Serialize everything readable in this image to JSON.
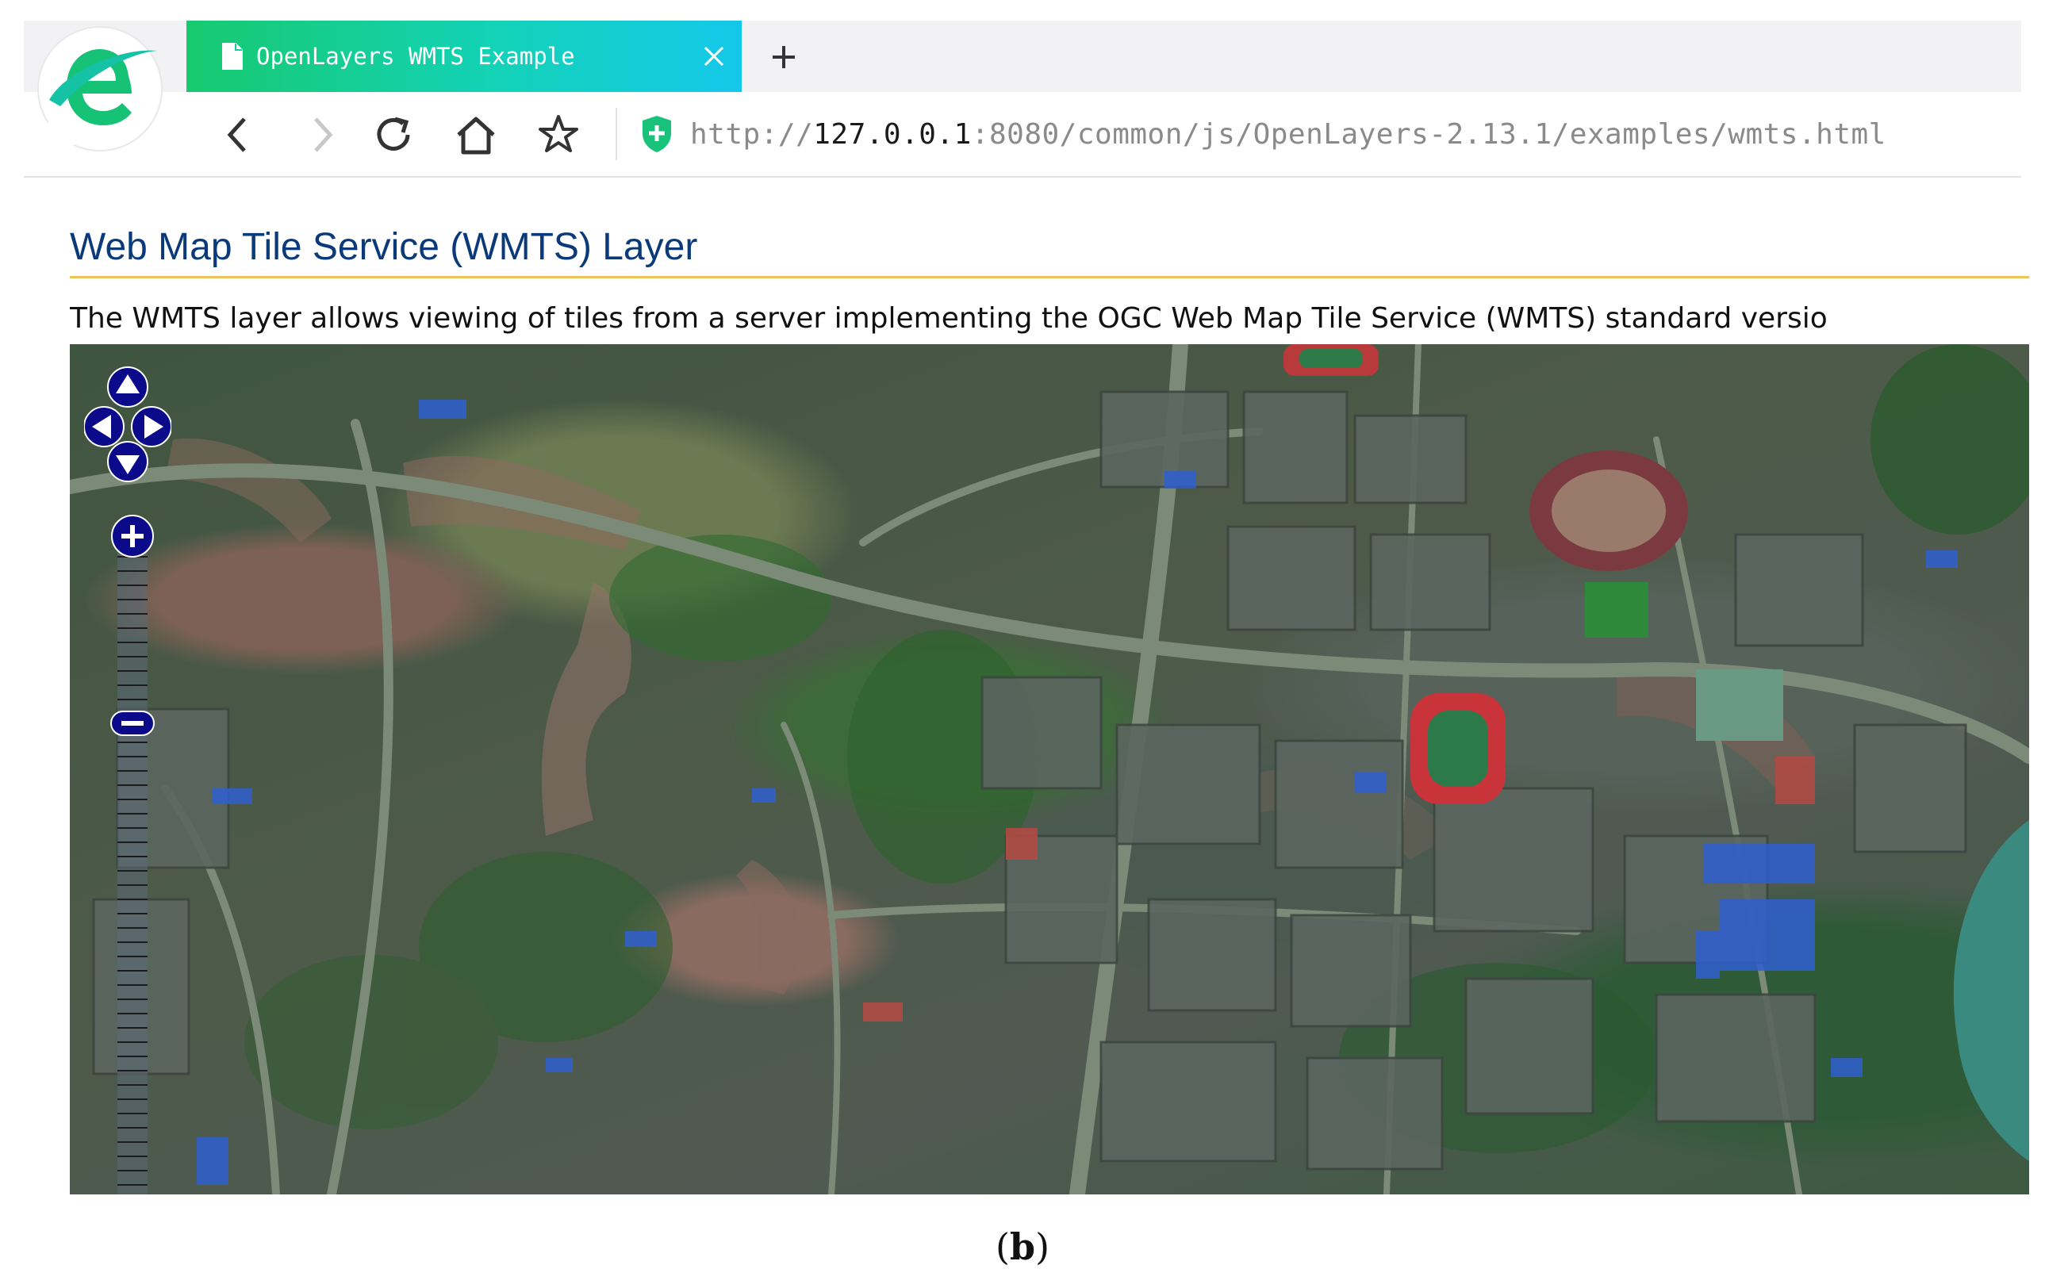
{
  "browser": {
    "tab": {
      "title": "OpenLayers WMTS Example"
    },
    "address": {
      "scheme": "http://",
      "host": "127.0.0.1",
      "rest": ":8080/common/js/OpenLayers-2.13.1/examples/wmts.html"
    }
  },
  "page": {
    "title": "Web Map Tile Service (WMTS) Layer",
    "description": "The WMTS layer allows viewing of tiles from a server implementing the OGC Web Map Tile Service (WMTS) standard versio"
  },
  "map": {
    "pan_controls": [
      "pan-north",
      "pan-west",
      "pan-east",
      "pan-south"
    ],
    "zoom_level": 0.24,
    "colors": {
      "control": "#0a0a8a",
      "accent": "#efc25a",
      "title": "#0a3a7a"
    }
  },
  "caption": {
    "open": "(",
    "label": "b",
    "close": ")"
  }
}
